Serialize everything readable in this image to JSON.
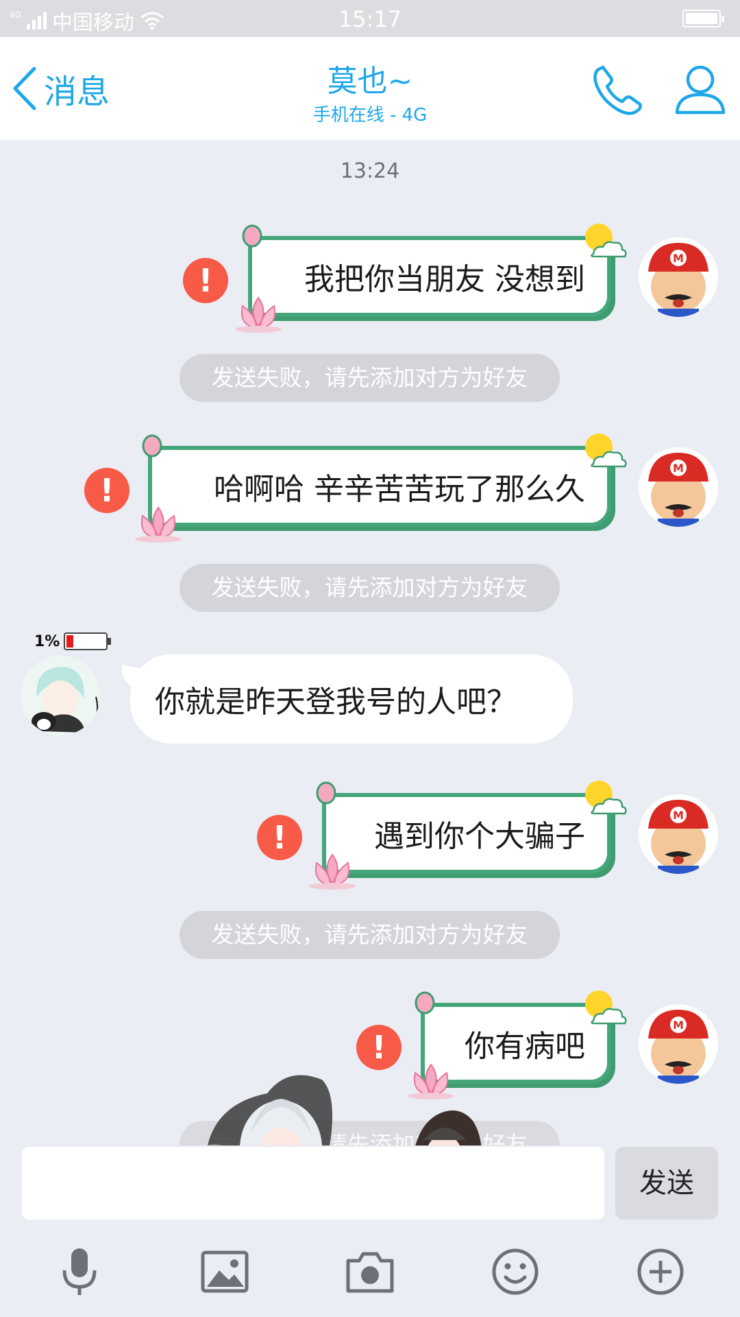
{
  "status_bar": {
    "network": "4G",
    "carrier": "中国移动",
    "time": "15:17"
  },
  "header": {
    "back_label": "消息",
    "contact_name": "莫也~",
    "status": "手机在线 - 4G"
  },
  "chat": {
    "timestamp": "13:24",
    "messages": [
      {
        "side": "right",
        "text": "我把你当朋友 没想到",
        "failed": true
      },
      {
        "side": "right",
        "text": "哈啊哈 辛辛苦苦玩了那么久",
        "failed": true
      },
      {
        "side": "left",
        "text": "你就是昨天登我号的人吧？",
        "battery_badge": "1%"
      },
      {
        "side": "right",
        "text": "遇到你个大骗子",
        "failed": true
      },
      {
        "side": "right",
        "text": "你有病吧",
        "failed": true
      }
    ],
    "system_notice": "发送失败，请先添加对方为好友"
  },
  "input": {
    "value": "",
    "send_label": "发送"
  },
  "toolbar": {
    "icons": [
      "microphone-icon",
      "image-icon",
      "camera-icon",
      "emoji-icon",
      "plus-icon"
    ]
  },
  "colors": {
    "accent": "#1ea7e8",
    "error": "#f85a48",
    "bubble_frame": "#44a67a",
    "background": "#ebedf4"
  }
}
